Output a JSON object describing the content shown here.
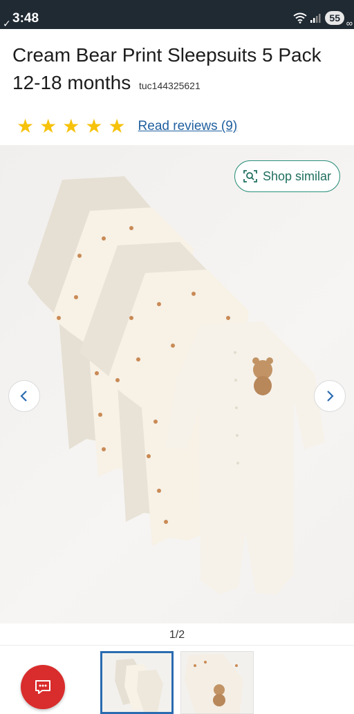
{
  "status_bar": {
    "time": "3:48",
    "battery": "55"
  },
  "product": {
    "title": "Cream Bear Print Sleepsuits 5 Pack 12-18 months",
    "sku": "tuc144325621",
    "rating_stars": 5,
    "reviews_label": "Read reviews (9)"
  },
  "gallery": {
    "shop_similar_label": "Shop similar",
    "counter": "1/2",
    "prev_icon": "chevron-left-icon",
    "next_icon": "chevron-right-icon"
  },
  "colors": {
    "star": "#f6c20b",
    "link": "#1f5f9e",
    "accent_green": "#2a8f7a",
    "chat_button": "#d92c2c",
    "status_bar": "#1f2a33"
  }
}
